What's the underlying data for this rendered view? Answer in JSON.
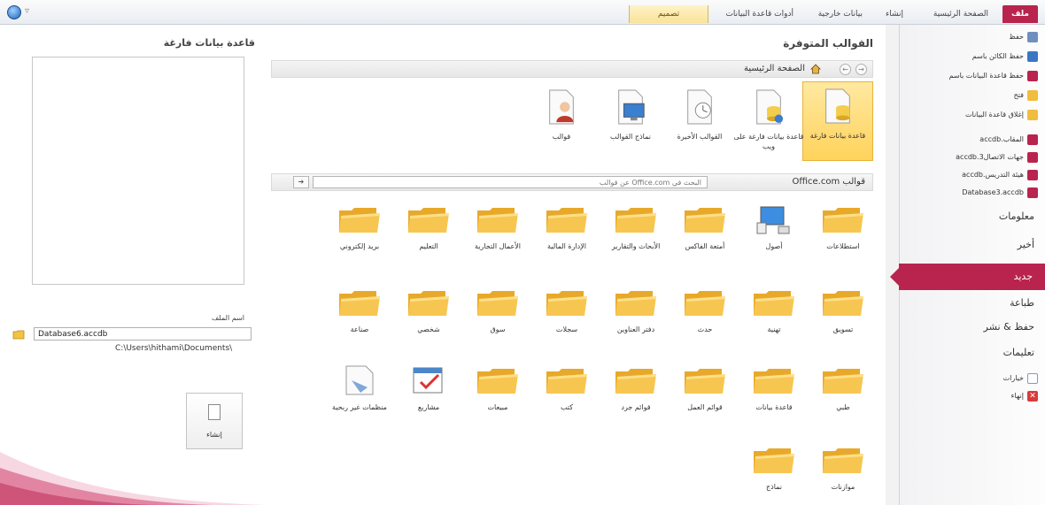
{
  "ribbon": {
    "tabs": [
      "ملف",
      "الصفحة الرئيسية",
      "إنشاء",
      "بيانات خارجية",
      "أدوات قاعدة البيانات",
      "تصميم"
    ]
  },
  "nav": {
    "commands": [
      {
        "label": "حفظ",
        "icon": "save-icon"
      },
      {
        "label": "حفظ الكائن باسم",
        "icon": "save-object-as-icon"
      },
      {
        "label": "حفظ قاعدة البيانات باسم",
        "icon": "save-database-as-icon"
      },
      {
        "label": "فتح",
        "icon": "open-folder-icon"
      },
      {
        "label": "إغلاق قاعدة البيانات",
        "icon": "close-database-icon"
      }
    ],
    "recent": [
      "المقاب.accdb",
      "جهات الاتصال3.accdb",
      "هيئة التدريس.accdb",
      "Database3.accdb"
    ],
    "sections": {
      "info": "معلومات",
      "recent": "أخير",
      "new": "جديد",
      "print": "طباعة",
      "save_publish": "حفظ & نشر",
      "help": "تعليمات",
      "options": "خيارات",
      "exit": "إنهاء"
    }
  },
  "middle": {
    "title": "القوالب المتوفرة",
    "breadcrumb": "الصفحة الرئيسية",
    "templates": [
      {
        "label": "قاعدة بيانات فارغة",
        "selected": true
      },
      {
        "label": "قاعدة بيانات فارغة على ويب"
      },
      {
        "label": "القوالب الأخيرة"
      },
      {
        "label": "نماذج القوالب"
      },
      {
        "label": "قوالب"
      }
    ],
    "office_label": "قوالب Office.com",
    "search_placeholder": "البحث في Office.com عن قوالب",
    "folders_row1": [
      "استطلاعات",
      "أصول",
      "أمتعة الفاكس",
      "الأبحاث والتقارير",
      "الإدارة المالية",
      "الأعمال التجارية",
      "التعليم",
      "بريد إلكتروني"
    ],
    "folders_row2": [
      "تسويق",
      "تهنية",
      "حدث",
      "دفتر العناوين",
      "سجلات",
      "سوق",
      "شخصي",
      "صناعة"
    ],
    "folders_row3": [
      "طبي",
      "قاعدة بيانات",
      "قوائم العمل",
      "قوائم جرد",
      "كتب",
      "مبيعات",
      "مشاريع",
      "منظمات غير ربحية"
    ],
    "folders_row4": [
      "موازنات",
      "نماذج"
    ]
  },
  "left": {
    "title": "قاعدة بيانات فارغة",
    "filename_label": "اسم الملف",
    "filename": "Database6.accdb",
    "path": "C:\\Users\\hithami\\Documents\\",
    "create_label": "إنشاء"
  }
}
